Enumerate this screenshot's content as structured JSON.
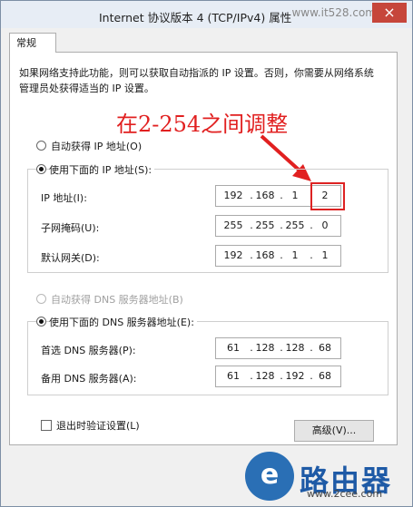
{
  "window": {
    "title": "Internet 协议版本 4 (TCP/IPv4) 属性",
    "close_icon": "×",
    "watermark": "www.it528.com"
  },
  "tab": {
    "label": "常规"
  },
  "description": "如果网络支持此功能，则可以获取自动指派的 IP 设置。否则，你需要从网络系统管理员处获得适当的 IP 设置。",
  "annotation": {
    "text": "在2-254之间调整",
    "color": "#e12020"
  },
  "ip_mode": {
    "auto_label": "自动获得 IP 地址(O)",
    "manual_label": "使用下面的 IP 地址(S):",
    "selected": "manual"
  },
  "ip_fields": [
    {
      "label": "IP 地址(I):",
      "octets": [
        "192",
        "168",
        "1",
        "2"
      ]
    },
    {
      "label": "子网掩码(U):",
      "octets": [
        "255",
        "255",
        "255",
        "0"
      ]
    },
    {
      "label": "默认网关(D):",
      "octets": [
        "192",
        "168",
        "1",
        "1"
      ]
    }
  ],
  "dns_mode": {
    "auto_label": "自动获得 DNS 服务器地址(B)",
    "manual_label": "使用下面的 DNS 服务器地址(E):",
    "selected": "manual"
  },
  "dns_fields": [
    {
      "label": "首选 DNS 服务器(P):",
      "octets": [
        "61",
        "128",
        "128",
        "68"
      ]
    },
    {
      "label": "备用 DNS 服务器(A):",
      "octets": [
        "61",
        "128",
        "192",
        "68"
      ]
    }
  ],
  "validate_on_exit": {
    "label": "退出时验证设置(L)",
    "checked": false
  },
  "advanced_button": {
    "label": "高级(V)..."
  },
  "logo": {
    "glyph": "e",
    "text": "路由器",
    "sub": "www.2cee.com"
  }
}
